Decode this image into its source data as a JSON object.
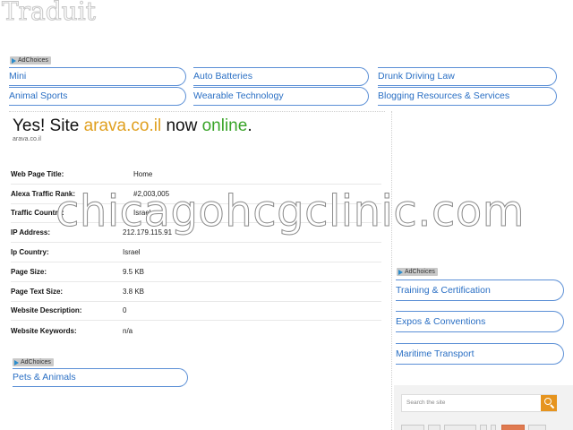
{
  "header": {
    "logo_text": "Traduit"
  },
  "ads": {
    "adchoices_label": "AdChoices",
    "top_links": [
      "Mini",
      "Auto Batteries",
      "Drunk Driving Law",
      "Animal Sports",
      "Wearable Technology",
      "Blogging Resources & Services"
    ],
    "side_links": [
      "Training & Certification",
      "Expos & Conventions",
      "Maritime Transport"
    ],
    "bottom_links": [
      "Pets & Animals"
    ]
  },
  "main": {
    "headline_prefix": "Yes! Site ",
    "headline_domain": "arava.co.il",
    "headline_middle": " now ",
    "headline_status": "online",
    "headline_suffix": ".",
    "subdomain": "arava.co.il",
    "rows": [
      {
        "label": "Web Page Title:",
        "value": "Home"
      },
      {
        "label": "Alexa Traffic Rank:",
        "value": "#2,003,005"
      },
      {
        "label": "Traffic Country:",
        "value": "Israel"
      },
      {
        "label": "IP Address:",
        "value": "212.179.115.91"
      },
      {
        "label": "Ip Country:",
        "value": "Israel"
      },
      {
        "label": "Page Size:",
        "value": "9.5 KB"
      },
      {
        "label": "Page Text Size:",
        "value": "3.8 KB"
      },
      {
        "label": "Website Description:",
        "value": "0"
      },
      {
        "label": "Website Keywords:",
        "value": "n/a"
      }
    ]
  },
  "watermark": "chicagohcgclinic.com",
  "search": {
    "placeholder": "Search the site"
  },
  "colors": {
    "link": "#2a6fc4",
    "domain": "#e0a020",
    "online": "#3aa52a",
    "search_button": "#e6941e"
  }
}
